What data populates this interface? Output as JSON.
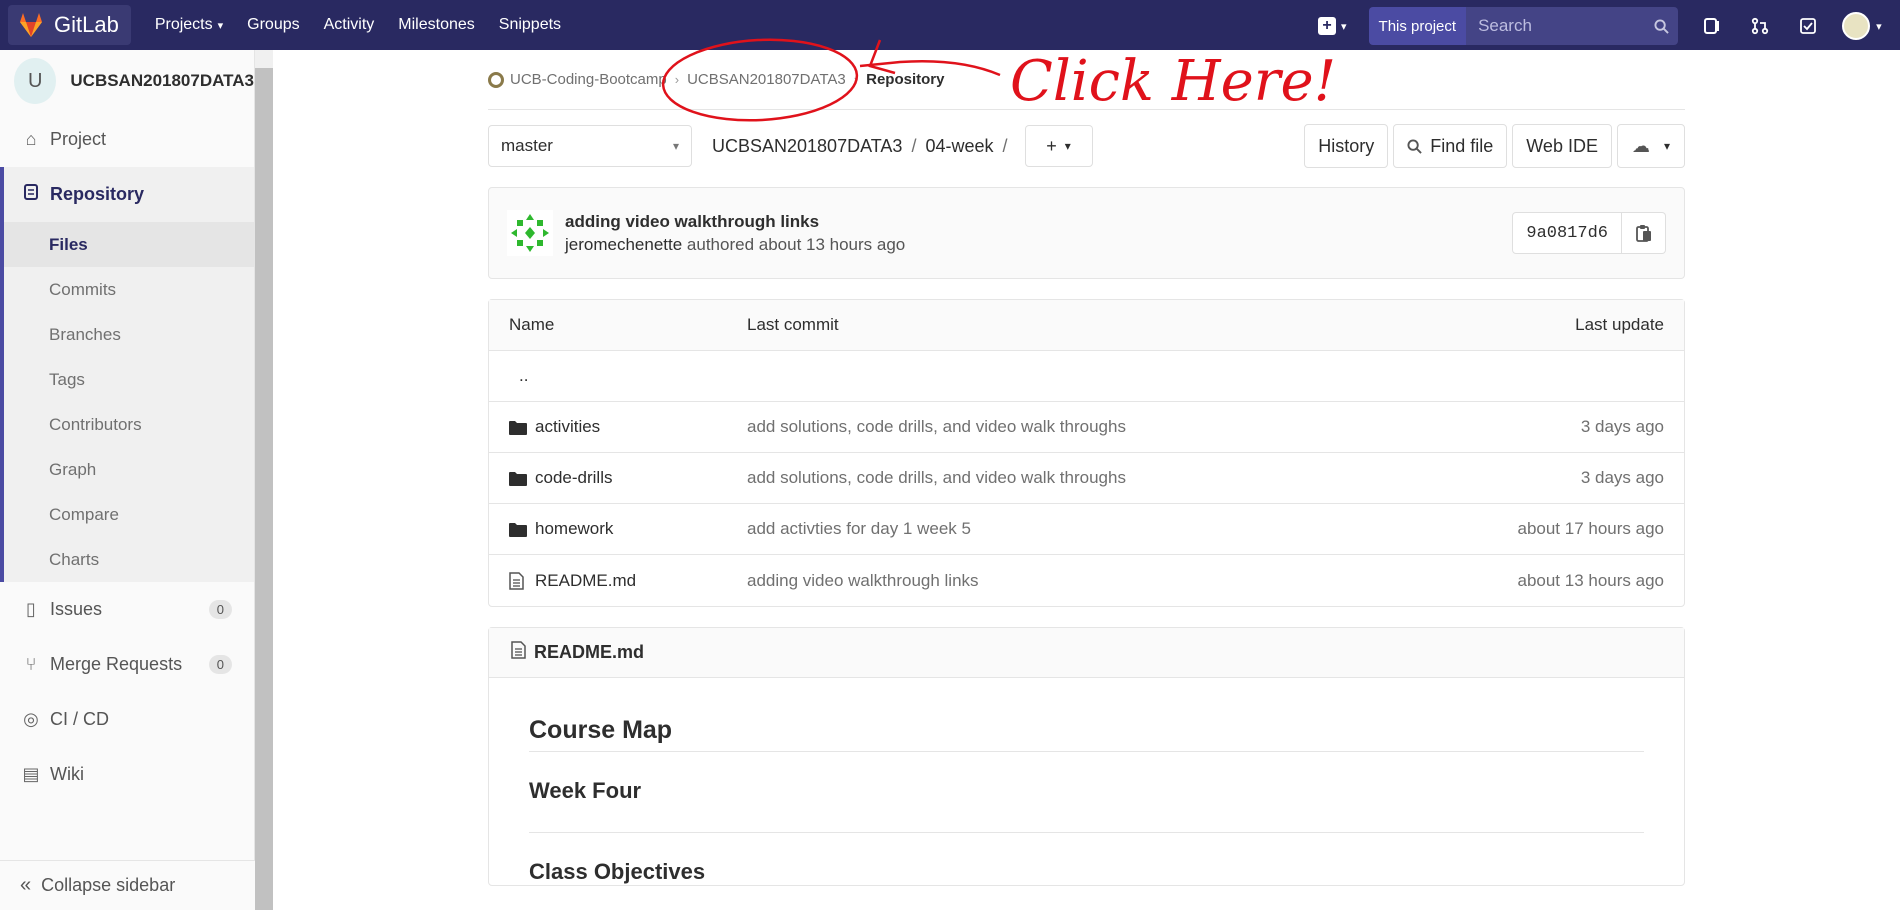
{
  "app": {
    "name": "GitLab"
  },
  "topnav": {
    "items": [
      {
        "label": "Projects",
        "has_dropdown": true
      },
      {
        "label": "Groups"
      },
      {
        "label": "Activity"
      },
      {
        "label": "Milestones"
      },
      {
        "label": "Snippets"
      }
    ],
    "search_scope": "This project",
    "search_placeholder": "Search"
  },
  "sidebar": {
    "avatar_letter": "U",
    "project_name": "UCBSAN201807DATA3",
    "items": [
      {
        "label": "Project",
        "icon": "home-icon"
      },
      {
        "label": "Repository",
        "icon": "repository-icon",
        "active": true
      }
    ],
    "repo_subitems": [
      "Files",
      "Commits",
      "Branches",
      "Tags",
      "Contributors",
      "Graph",
      "Compare",
      "Charts"
    ],
    "active_subitem": "Files",
    "lower_items": [
      {
        "label": "Issues",
        "count": "0"
      },
      {
        "label": "Merge Requests",
        "count": "0"
      },
      {
        "label": "CI / CD"
      },
      {
        "label": "Wiki"
      }
    ],
    "collapse_label": "Collapse sidebar"
  },
  "breadcrumb": {
    "group": "UCB-Coding-Bootcamp",
    "project": "UCBSAN201807DATA3",
    "current": "Repository"
  },
  "annotation": {
    "text": "Click Here!",
    "color": "#e0121b"
  },
  "toolbar": {
    "branch": "master",
    "path": [
      "UCBSAN201807DATA3",
      "04-week"
    ],
    "history_label": "History",
    "find_file_label": "Find file",
    "web_ide_label": "Web IDE"
  },
  "commit": {
    "title": "adding video walkthrough links",
    "author": "jeromechenette",
    "meta_suffix": " authored about 13 hours ago",
    "sha": "9a0817d6"
  },
  "files": {
    "headers": {
      "name": "Name",
      "last_commit": "Last commit",
      "last_update": "Last update"
    },
    "parent": "..",
    "rows": [
      {
        "name": "activities",
        "type": "folder",
        "commit": "add solutions, code drills, and video walk throughs",
        "updated": "3 days ago"
      },
      {
        "name": "code-drills",
        "type": "folder",
        "commit": "add solutions, code drills, and video walk throughs",
        "updated": "3 days ago"
      },
      {
        "name": "homework",
        "type": "folder",
        "commit": "add activties for day 1 week 5",
        "updated": "about 17 hours ago"
      },
      {
        "name": "README.md",
        "type": "file",
        "commit": "adding video walkthrough links",
        "updated": "about 13 hours ago"
      }
    ]
  },
  "readme": {
    "filename": "README.md",
    "h1": "Course Map",
    "h2": "Week Four",
    "h3": "Class Objectives"
  },
  "colors": {
    "nav_bg": "#292961",
    "accent": "#4b4ba3",
    "annotation": "#e0121b"
  }
}
